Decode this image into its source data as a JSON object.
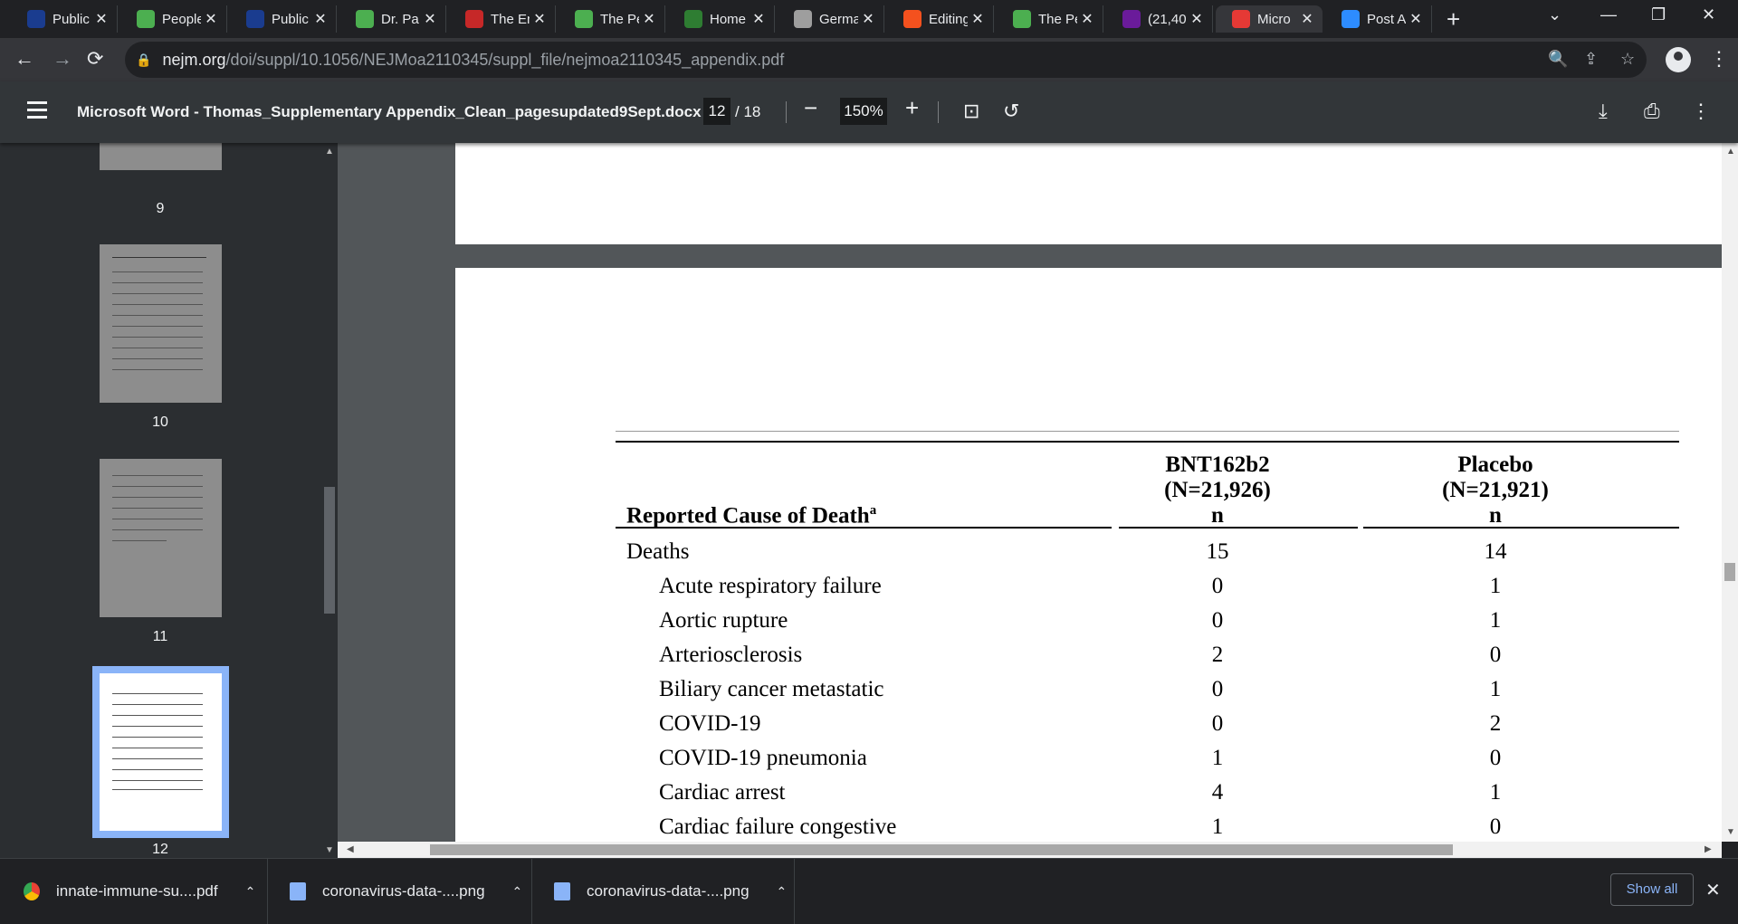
{
  "browser": {
    "tabs": [
      {
        "title": "Public",
        "color": "#1a3c8f",
        "icon": "nejm-icon"
      },
      {
        "title": "People",
        "color": "#4caf50",
        "icon": "rumble-icon"
      },
      {
        "title": "Public",
        "color": "#1a3c8f",
        "icon": "nejm-icon"
      },
      {
        "title": "Dr. Pa",
        "color": "#4caf50",
        "icon": "rumble-icon"
      },
      {
        "title": "The En",
        "color": "#c62828",
        "icon": "bi-icon"
      },
      {
        "title": "The Pe",
        "color": "#4caf50",
        "icon": "rumble-icon"
      },
      {
        "title": "Home",
        "color": "#2e7d32",
        "icon": "g-icon"
      },
      {
        "title": "Germa",
        "color": "#9e9e9e",
        "icon": "map-icon"
      },
      {
        "title": "Editing",
        "color": "#f4511e",
        "icon": "substack-icon"
      },
      {
        "title": "The Pe",
        "color": "#4caf50",
        "icon": "rumble-icon"
      },
      {
        "title": "(21,40",
        "color": "#6a1b9a",
        "icon": "mail-icon"
      },
      {
        "title": "Micro",
        "color": "#e53935",
        "icon": "coronavirus-icon"
      },
      {
        "title": "Post A",
        "color": "#2d8cff",
        "icon": "zoom-icon"
      }
    ],
    "url_host": "nejm.org",
    "url_path": "/doi/suppl/10.1056/NEJMoa2110345/suppl_file/nejmoa2110345_appendix.pdf"
  },
  "pdf": {
    "title": "Microsoft Word - Thomas_Supplementary Appendix_Clean_pagesupdated9Sept.docx",
    "page": "12",
    "total": "/ 18",
    "zoom": "150%",
    "thumbs": [
      "9",
      "10",
      "11",
      "12"
    ]
  },
  "table": {
    "col_cause": "Reported Cause of Death",
    "col_cause_sup": "a",
    "col1_name": "BNT162b2",
    "col1_n": "(N=21,926)",
    "col1_unit": "n",
    "col2_name": "Placebo",
    "col2_n": "(N=21,921)",
    "col2_unit": "n",
    "rows": [
      {
        "label": "Deaths",
        "bnt": "15",
        "placebo": "14",
        "indent": false
      },
      {
        "label": "Acute respiratory failure",
        "bnt": "0",
        "placebo": "1",
        "indent": true
      },
      {
        "label": "Aortic rupture",
        "bnt": "0",
        "placebo": "1",
        "indent": true
      },
      {
        "label": "Arteriosclerosis",
        "bnt": "2",
        "placebo": "0",
        "indent": true
      },
      {
        "label": "Biliary cancer metastatic",
        "bnt": "0",
        "placebo": "1",
        "indent": true
      },
      {
        "label": "COVID-19",
        "bnt": "0",
        "placebo": "2",
        "indent": true
      },
      {
        "label": "COVID-19 pneumonia",
        "bnt": "1",
        "placebo": "0",
        "indent": true
      },
      {
        "label": "Cardiac arrest",
        "bnt": "4",
        "placebo": "1",
        "indent": true
      },
      {
        "label": "Cardiac failure congestive",
        "bnt": "1",
        "placebo": "0",
        "indent": true
      }
    ]
  },
  "downloads": {
    "items": [
      {
        "name": "innate-immune-su....pdf",
        "icon": "chrome-icon"
      },
      {
        "name": "coronavirus-data-....png",
        "icon": "image-file-icon"
      },
      {
        "name": "coronavirus-data-....png",
        "icon": "image-file-icon"
      }
    ],
    "show_all": "Show all"
  }
}
